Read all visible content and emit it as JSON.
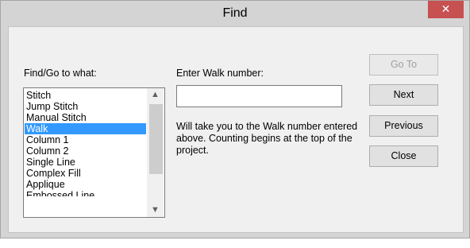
{
  "window": {
    "title": "Find",
    "close_glyph": "✕"
  },
  "find_goto": {
    "label": "Find/Go to what:",
    "items": [
      "Stitch",
      "Jump Stitch",
      "Manual Stitch",
      "Walk",
      "Column 1",
      "Column 2",
      "Single Line",
      "Complex Fill",
      "Applique",
      "Embossed Line"
    ],
    "selected": "Walk",
    "scroll_up_icon": "chevron-up-icon",
    "scroll_down_icon": "chevron-down-icon",
    "scroll_up_glyph": "▲",
    "scroll_down_glyph": "▼"
  },
  "entry": {
    "label": "Enter Walk number:",
    "value": "",
    "help_text": "Will take you to the Walk number entered above.  Counting begins at the top of the project."
  },
  "buttons": {
    "goto": "Go To",
    "next": "Next",
    "previous": "Previous",
    "close": "Close"
  },
  "colors": {
    "selection": "#3399ff",
    "close_button": "#c75050"
  }
}
